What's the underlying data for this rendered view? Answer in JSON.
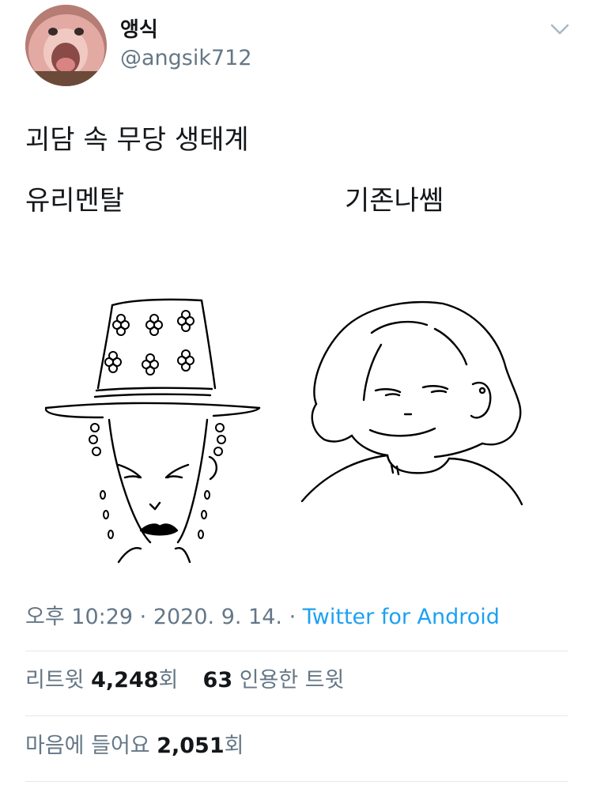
{
  "author": {
    "display_name": "앵식",
    "handle": "@angsik712"
  },
  "menu_icon": "chevron-down-icon",
  "tweet": {
    "text": "괴담 속 무당 생태계",
    "image_labels": {
      "left": "유리멘탈",
      "right": "기존나쎔"
    }
  },
  "meta": {
    "time": "오후 10:29",
    "sep1": " · ",
    "date": "2020. 9. 14.",
    "sep2": " · ",
    "source": "Twitter for Android"
  },
  "retweets": {
    "label": "리트윗 ",
    "count": "4,248",
    "suffix": "회"
  },
  "quotes": {
    "count": "63",
    "label": " 인용한 트윗"
  },
  "likes": {
    "label": "마음에 들어요 ",
    "count": "2,051",
    "suffix": "회"
  },
  "colors": {
    "text": "#14171a",
    "secondary": "#657786",
    "link": "#1da1f2",
    "divider": "#e1e8ed"
  }
}
